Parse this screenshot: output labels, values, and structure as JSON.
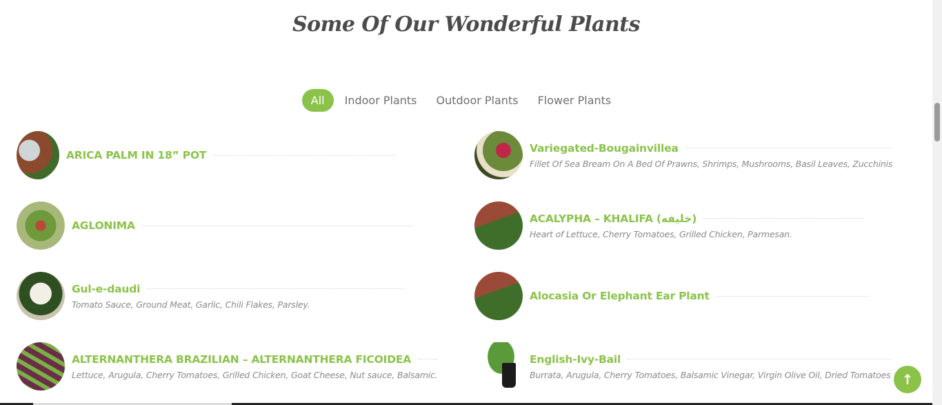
{
  "section_title": "Some Of Our Wonderful Plants",
  "tabs": [
    "All",
    "Indoor Plants",
    "Outdoor Plants",
    "Flower Plants"
  ],
  "plants_left": [
    {
      "name": "ARICA PALM IN 18” POT",
      "desc": ""
    },
    {
      "name": "AGLONIMA",
      "desc": ""
    },
    {
      "name": "Gul-e-daudi",
      "desc": "Tomato Sauce, Ground Meat, Garlic, Chili Flakes, Parsley."
    },
    {
      "name": "ALTERNANTHERA BRAZILIAN – ALTERNANTHERA FICOIDEA",
      "desc": "Lettuce, Arugula, Cherry Tomatoes, Grilled Chicken, Goat Cheese, Nut sauce, Balsamic."
    }
  ],
  "plants_right": [
    {
      "name": "Variegated-Bougainvillea",
      "desc": "Fillet Of Sea Bream On A Bed Of Prawns, Shrimps, Mushrooms, Basil Leaves, Zucchinis"
    },
    {
      "name": "ACALYPHA – KHALIFA (خليفه)",
      "desc": "Heart of Lettuce, Cherry Tomatoes, Grilled Chicken, Parmesan."
    },
    {
      "name": "Alocasia Or Elephant Ear Plant",
      "desc": ""
    },
    {
      "name": "English-Ivy-Bail",
      "desc": "Burrata, Arugula, Cherry Tomatoes, Balsamic Vinegar, Virgin Olive Oil, Dried Tomatoes"
    }
  ],
  "icons": {
    "back_to_top": "arrow-up-icon"
  },
  "colors": {
    "accent": "#8bc34a",
    "title": "#4b4b4b",
    "muted": "#8a8a8a"
  }
}
